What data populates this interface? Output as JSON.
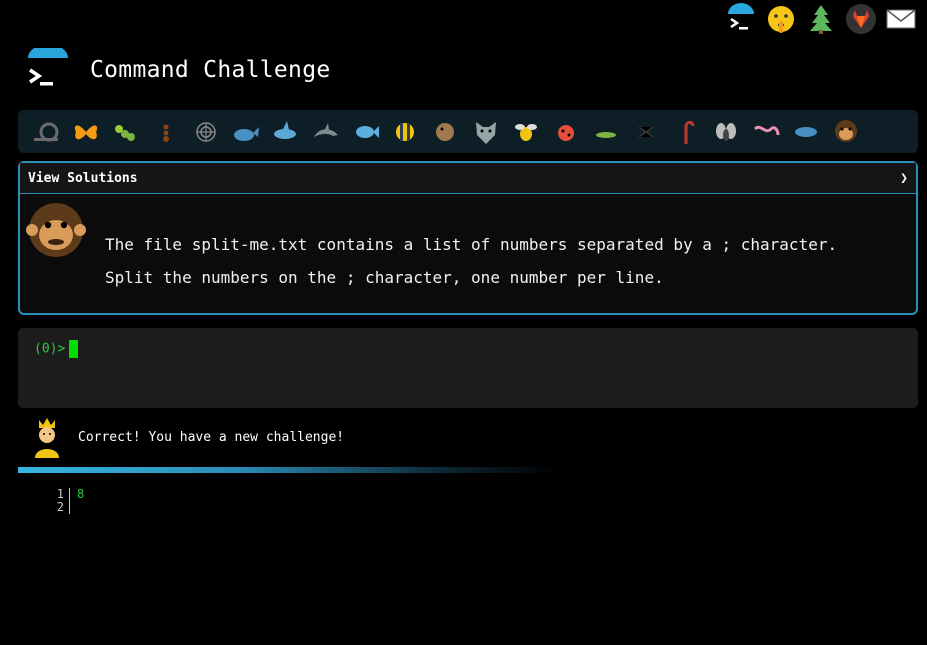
{
  "app": {
    "title": "Command Challenge"
  },
  "topbar": {
    "icons": [
      "logo-icon",
      "shush-face-icon",
      "tree-icon",
      "gitlab-icon",
      "mail-icon"
    ]
  },
  "animals": [
    "snail",
    "butterfly",
    "caterpillar",
    "ant",
    "spider-web",
    "whale",
    "shark",
    "dolphin",
    "fish",
    "tropical-fish",
    "blowfish",
    "wolf",
    "bee",
    "ladybug",
    "cricket",
    "spider",
    "scorpion",
    "fly",
    "worm",
    "microbe",
    "chimp"
  ],
  "solutions": {
    "header_label": "View Solutions",
    "chevron": "❯",
    "challenge_line1": "The file split-me.txt contains a list of numbers separated by a ; character.",
    "challenge_line2": "Split the numbers on the ; character, one number per line."
  },
  "terminal": {
    "prompt": "(0)>"
  },
  "feedback": {
    "message": "Correct! You have a new challenge!"
  },
  "progress": {
    "value": 0.58
  },
  "output": {
    "lines": [
      {
        "num": "1",
        "text": "8"
      },
      {
        "num": "2",
        "text": ""
      }
    ]
  },
  "colors": {
    "accent": "#2c8fb8",
    "prompt_green": "#2ecc40",
    "cursor": "#00e000",
    "animal_bar_bg": "#0d1e27"
  }
}
